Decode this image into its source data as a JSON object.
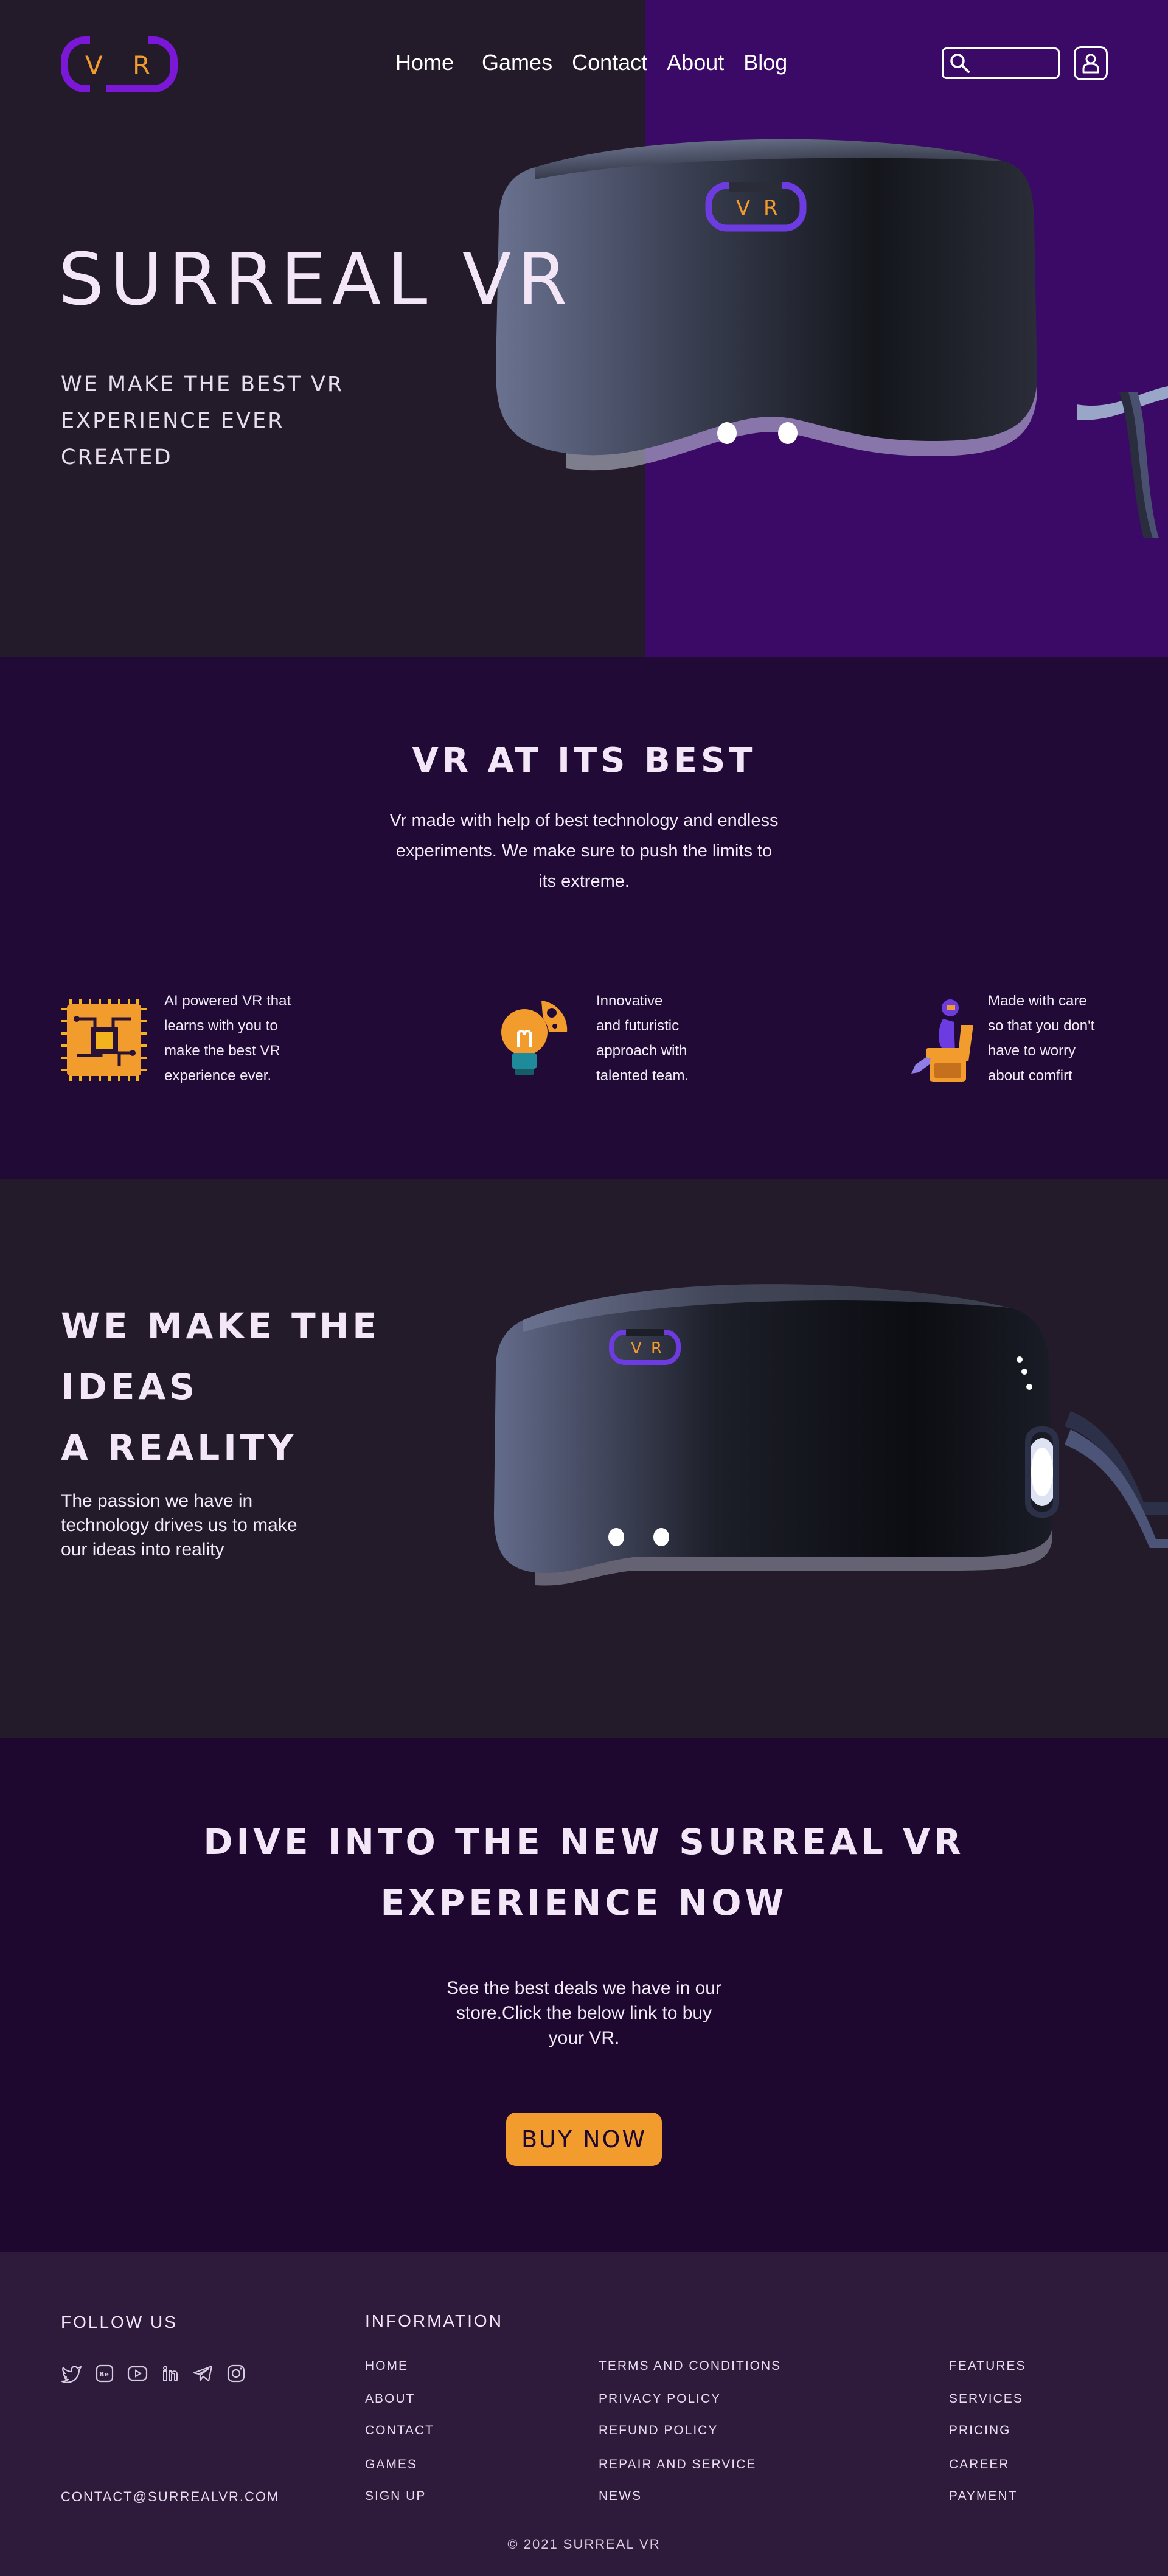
{
  "colors": {
    "hero_bg": "#231b2a",
    "hero_purple": "#3a0a66",
    "section_dark_purple": "#210a35",
    "accent_orange": "#f39c2e",
    "logo_purple": "#7b17d6",
    "footer_bg": "#2e1b3c"
  },
  "logo": {
    "letter_1": "V",
    "letter_2": "R"
  },
  "nav": {
    "items": [
      "Home",
      "Games",
      "Contact",
      "About",
      "Blog"
    ]
  },
  "search": {
    "placeholder": ""
  },
  "hero": {
    "title": "SURREAL VR",
    "subtitle_lines": [
      "WE MAKE THE BEST VR",
      "EXPERIENCE EVER",
      "CREATED"
    ]
  },
  "best": {
    "title": "VR AT ITS BEST",
    "description": "Vr made with help of best technology and endless experiments. We make sure to push the limits to its extreme.",
    "features": [
      {
        "icon": "chip-icon",
        "lines": [
          "AI powered VR that",
          "learns with you to",
          "make the best VR",
          "experience ever."
        ]
      },
      {
        "icon": "lightbulb-puzzle-icon",
        "lines": [
          "Innovative",
          "and futuristic",
          "approach with",
          "talented team."
        ]
      },
      {
        "icon": "vr-chair-person-icon",
        "lines": [
          "Made with care",
          "so that you don't",
          "have to worry",
          "about comfirt"
        ]
      }
    ]
  },
  "ideas": {
    "title_lines": [
      "WE MAKE THE IDEAS",
      "A REALITY"
    ],
    "description": "The passion we have in technology drives us to make our ideas into reality"
  },
  "dive": {
    "title_lines": [
      "DIVE INTO THE NEW SURREAL VR",
      "EXPERIENCE NOW"
    ],
    "description": "See the best deals we have in our store.Click the below link to buy your VR.",
    "button": "BUY NOW"
  },
  "footer": {
    "follow_title": "FOLLOW US",
    "socials": [
      "twitter-icon",
      "behance-icon",
      "youtube-icon",
      "linkedin-icon",
      "telegram-icon",
      "instagram-icon"
    ],
    "info_title": "INFORMATION",
    "col1": [
      "HOME",
      "ABOUT",
      "CONTACT",
      "GAMES",
      "SIGN UP"
    ],
    "col2": [
      "TERMS AND CONDITIONS",
      "PRIVACY POLICY",
      "REFUND POLICY",
      "REPAIR AND SERVICE",
      "NEWS"
    ],
    "col3": [
      "FEATURES",
      "SERVICES",
      "PRICING",
      "CAREER",
      "PAYMENT"
    ],
    "email": "CONTACT@SURREALVR.COM",
    "copyright": "© 2021 SURREAL VR"
  }
}
